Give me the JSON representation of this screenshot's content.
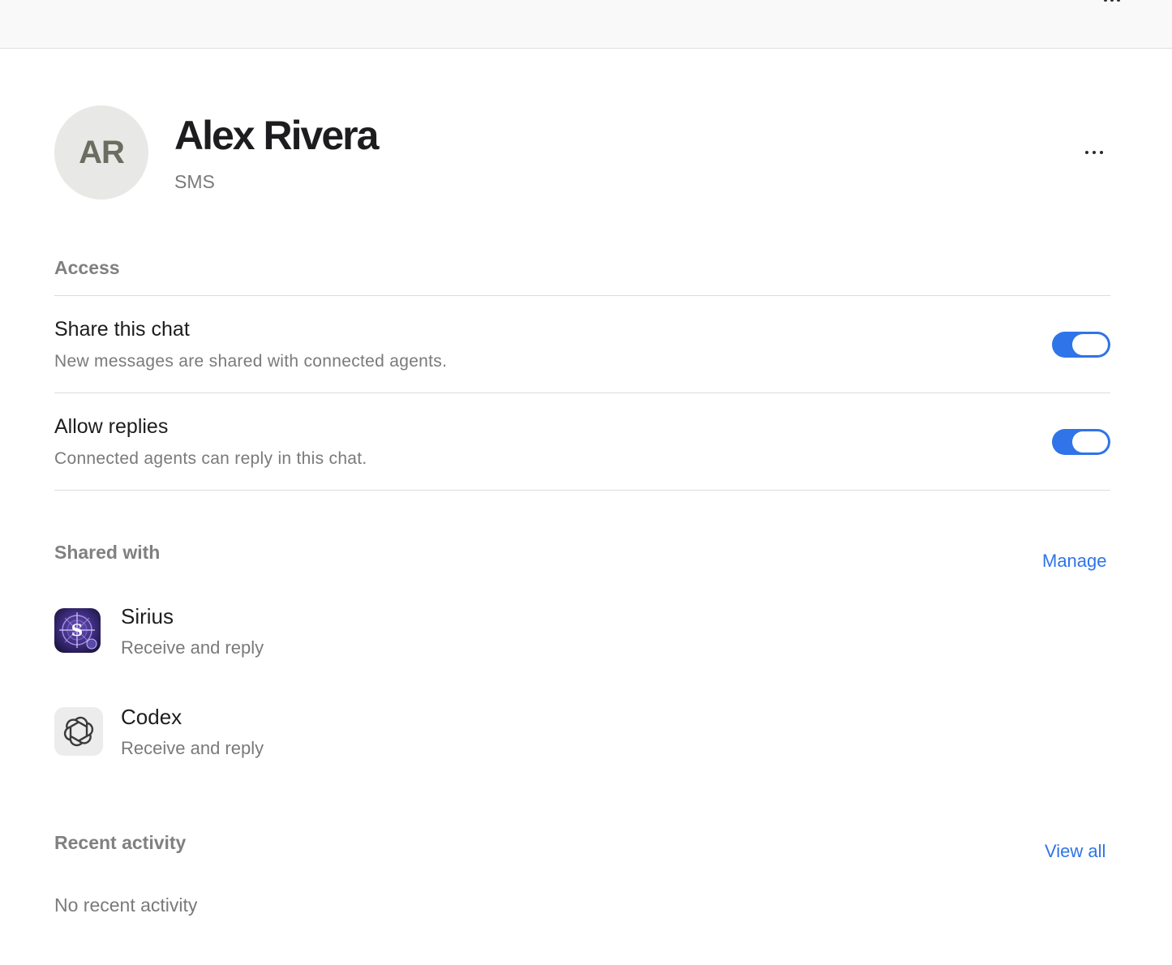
{
  "contact": {
    "initials": "AR",
    "name": "Alex Rivera",
    "channel": "SMS"
  },
  "access": {
    "title": "Access",
    "settings": [
      {
        "title": "Share this chat",
        "description": "New messages are shared with connected agents.",
        "enabled": true
      },
      {
        "title": "Allow replies",
        "description": "Connected agents can reply in this chat.",
        "enabled": true
      }
    ]
  },
  "shared_with": {
    "title": "Shared with",
    "manage_label": "Manage",
    "agents": [
      {
        "name": "Sirius",
        "permission": "Receive and reply",
        "icon": "sirius-compass-icon"
      },
      {
        "name": "Codex",
        "permission": "Receive and reply",
        "icon": "openai-knot-icon"
      }
    ]
  },
  "recent_activity": {
    "title": "Recent activity",
    "view_all_label": "View all",
    "empty_text": "No recent activity"
  },
  "colors": {
    "accent": "#2f74e8",
    "muted_text": "#7a7a7a",
    "avatar_bg": "#e8e8e6"
  }
}
